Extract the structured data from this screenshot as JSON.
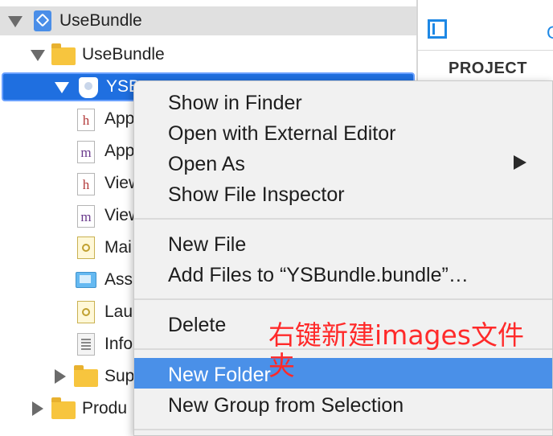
{
  "navigator": {
    "items": [
      {
        "label": "UseBundle",
        "kind": "project"
      },
      {
        "label": "UseBundle",
        "kind": "folder"
      },
      {
        "label": "YSB",
        "kind": "bundle"
      },
      {
        "label": "App",
        "kind": "h"
      },
      {
        "label": "App",
        "kind": "m"
      },
      {
        "label": "View",
        "kind": "h"
      },
      {
        "label": "View",
        "kind": "m"
      },
      {
        "label": "Mai",
        "kind": "storyboard"
      },
      {
        "label": "Ass",
        "kind": "assets"
      },
      {
        "label": "Lau",
        "kind": "storyboard"
      },
      {
        "label": "Info",
        "kind": "plist"
      },
      {
        "label": "Sup",
        "kind": "folder"
      },
      {
        "label": "Produ",
        "kind": "folder"
      }
    ]
  },
  "inspector": {
    "blue_char": "C",
    "section_label": "PROJECT"
  },
  "context_menu": {
    "items": [
      {
        "label": "Show in Finder"
      },
      {
        "label": "Open with External Editor"
      },
      {
        "label": "Open As",
        "has_submenu": true
      },
      {
        "label": "Show File Inspector"
      },
      {
        "label": "New File"
      },
      {
        "label": "Add Files to “YSBundle.bundle”…"
      },
      {
        "label": "Delete"
      },
      {
        "label": "New Folder",
        "active": true
      },
      {
        "label": "New Group from Selection"
      }
    ]
  },
  "annotation": {
    "text": "右键新建images文件夹",
    "color": "#ff2a2a"
  },
  "colors": {
    "selection_blue": "#1f6fe0",
    "menu_highlight": "#4a90e8",
    "menu_bg": "#f1f1f1"
  }
}
